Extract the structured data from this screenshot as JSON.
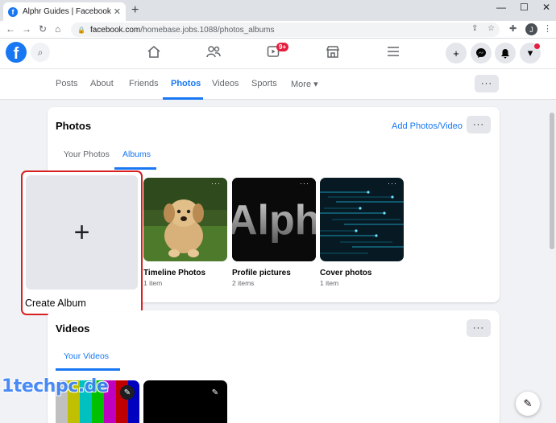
{
  "browser": {
    "tab_title": "Alphr Guides | Facebook",
    "tab_close": "✕",
    "new_tab": "+",
    "win_min": "—",
    "win_max": "☐",
    "win_close": "✕",
    "back": "←",
    "forward": "→",
    "reload": "↻",
    "home": "⌂",
    "url_domain": "facebook.com",
    "url_path": "/homebase.jobs.1088/photos_albums",
    "profile_initial": "J"
  },
  "fb_header": {
    "logo": "f",
    "notif_badge": "9+"
  },
  "profile_tabs": {
    "items": [
      "Posts",
      "About",
      "Friends",
      "Photos",
      "Videos",
      "Sports",
      "More ▾"
    ],
    "active": "Photos",
    "more_button": "···"
  },
  "photos_card": {
    "title": "Photos",
    "add_link": "Add Photos/Video",
    "more_button": "···",
    "subtabs": [
      "Your Photos",
      "Albums"
    ],
    "active_subtab": "Albums",
    "create_album": {
      "plus": "+",
      "label": "Create Album"
    },
    "albums": [
      {
        "name": "Timeline Photos",
        "count": "1 item",
        "dots": "···"
      },
      {
        "name": "Profile pictures",
        "count": "2 items",
        "dots": "···",
        "thumb_text": "Alph"
      },
      {
        "name": "Cover photos",
        "count": "1 item",
        "dots": "···"
      }
    ]
  },
  "videos_card": {
    "title": "Videos",
    "more_button": "···",
    "subtab": "Your Videos"
  },
  "watermark": "1techpc.de",
  "colors": {
    "accent": "#1877f2",
    "highlight": "#d92020",
    "badge": "#e41e3f"
  }
}
